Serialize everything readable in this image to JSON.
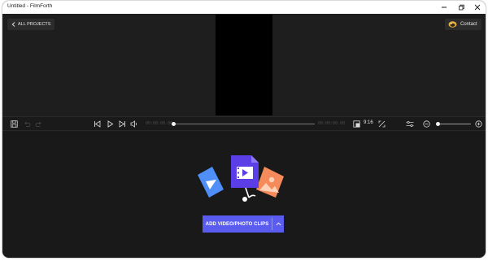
{
  "window": {
    "title": "Untitled - FilmForth",
    "accent_color": "#5a5cf0"
  },
  "preview": {
    "back_label": "ALL PROJECTS",
    "contact_label": "Contact"
  },
  "toolbar": {
    "icons": [
      "save-icon",
      "undo-icon",
      "redo-icon",
      "skip-back-icon",
      "play-icon",
      "skip-forward-icon",
      "volume-icon",
      "aspect-ratio-icon",
      "fullscreen-icon",
      "settings-sliders-icon",
      "zoom-out-icon",
      "zoom-in-icon"
    ],
    "current_time": "00:00:00.00",
    "total_time": "00:00:00.00",
    "aspect_ratio": "9:16"
  },
  "workspace": {
    "add_button_label": "ADD VIDEO/PHOTO CLIPS"
  }
}
